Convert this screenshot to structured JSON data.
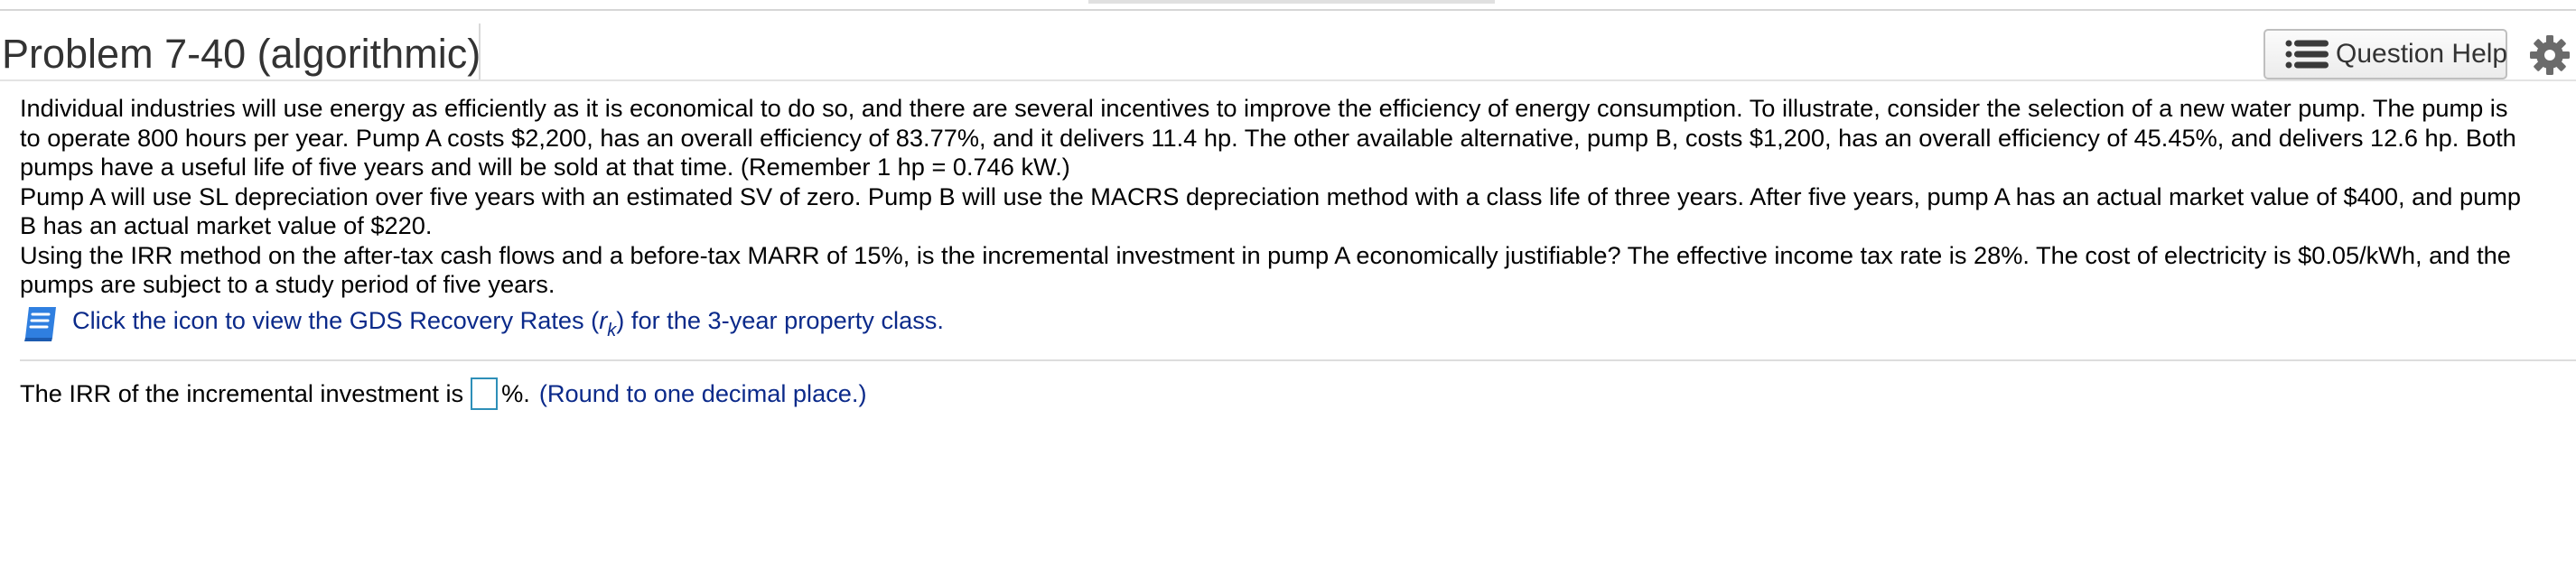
{
  "header": {
    "title": "Problem 7-40 (algorithmic)",
    "help_button_label": "Question Help",
    "help_icon": "list-icon",
    "settings_icon": "gear-icon"
  },
  "problem": {
    "paragraph1": "Individual industries will use energy as efficiently as it is economical to do so, and there are several incentives to improve the efficiency of energy consumption. To illustrate, consider the selection of a new water pump. The pump is to operate 800 hours per year. Pump A costs $2,200, has an overall efficiency of 83.77%, and it delivers 11.4 hp. The other available alternative, pump B, costs $1,200, has an overall efficiency of 45.45%, and delivers 12.6 hp. Both pumps have a useful life of five years and will be sold at that time. (Remember 1 hp = 0.746 kW.)",
    "paragraph2": "Pump A will use SL depreciation over five years with an estimated SV of zero. Pump B will use the MACRS depreciation method with a class life of three years. After five years, pump A has an actual market value of $400, and pump B has an actual market value of $220.",
    "paragraph3": "Using the IRR method on the after-tax cash flows and a before-tax MARR of 15%, is the incremental investment in pump A economically justifiable? The effective income tax rate is 28%. The cost of electricity is $0.05/kWh, and the pumps are subject to a study period of five years."
  },
  "gds_link": {
    "icon": "book-icon",
    "text_before": "Click the icon to view the GDS Recovery Rates (",
    "r_symbol": "r",
    "subscript": "k",
    "text_after": ") for the 3-year property class."
  },
  "answer": {
    "prompt_before": "The IRR of the incremental investment is",
    "value": "",
    "suffix": "%.",
    "hint": "(Round to one decimal place.)"
  },
  "colors": {
    "link_blue": "#0b2a8a",
    "book_blue": "#2f7fe0",
    "input_border": "#2e8fb8",
    "title_gray": "#333333"
  }
}
